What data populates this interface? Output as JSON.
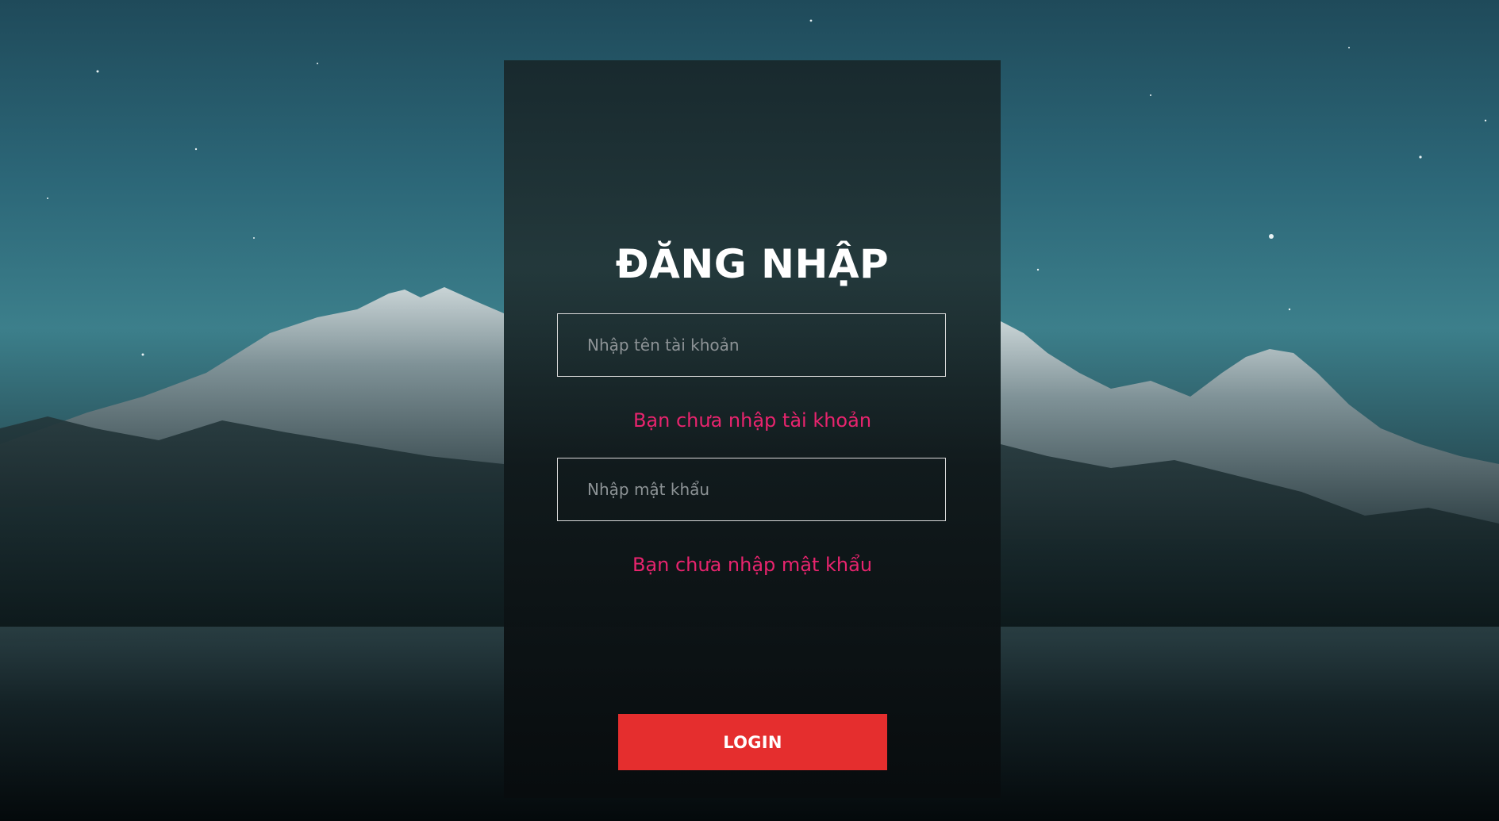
{
  "login": {
    "title": "ĐĂNG NHẬP",
    "username_placeholder": "Nhập tên tài khoản",
    "username_value": "",
    "username_error": "Bạn chưa nhập tài khoản",
    "password_placeholder": "Nhập mật khẩu",
    "password_value": "",
    "password_error": "Bạn chưa nhập mật khẩu",
    "submit_label": "LOGIN"
  },
  "colors": {
    "error_text": "#e8246e",
    "button_background": "#e52e2e",
    "button_text": "#ffffff",
    "title_text": "#ffffff",
    "card_background": "#141e20"
  },
  "background": {
    "scene": "night sky with snowy mountain range"
  }
}
